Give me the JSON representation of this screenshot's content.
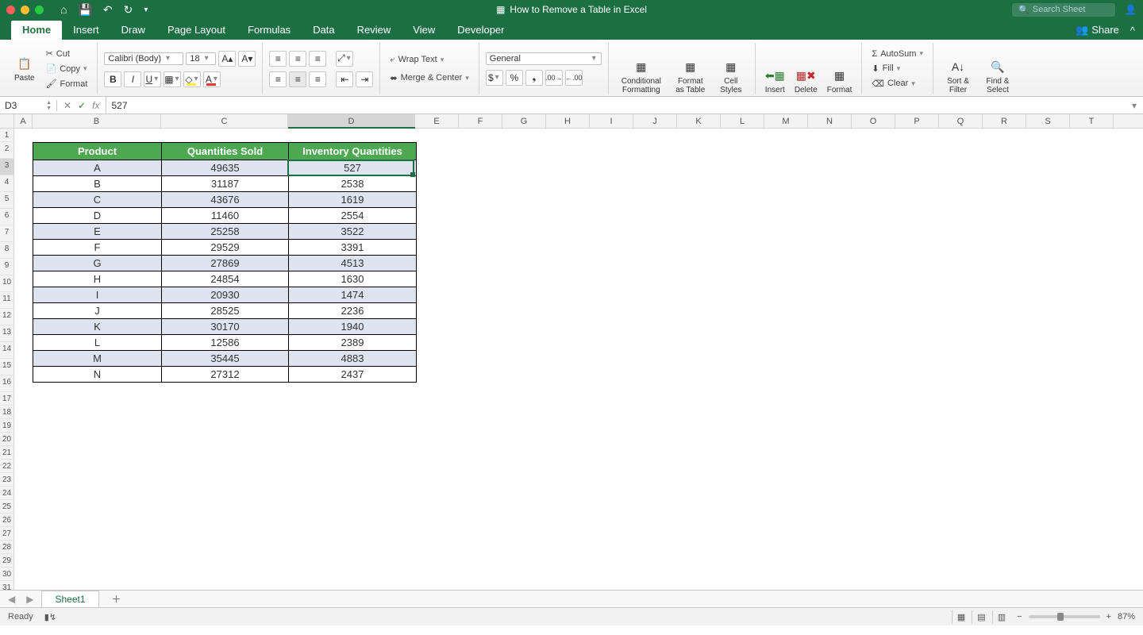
{
  "titlebar": {
    "title": "How to Remove a Table in Excel",
    "search_placeholder": "Search Sheet"
  },
  "tabs": {
    "items": [
      "Home",
      "Insert",
      "Draw",
      "Page Layout",
      "Formulas",
      "Data",
      "Review",
      "View",
      "Developer"
    ],
    "active": "Home",
    "share": "Share"
  },
  "ribbon": {
    "paste": "Paste",
    "cut": "Cut",
    "copy": "Copy",
    "format_painter": "Format",
    "font_name": "Calibri (Body)",
    "font_size": "18",
    "wrap": "Wrap Text",
    "merge": "Merge & Center",
    "number_format": "General",
    "cond_fmt": "Conditional Formatting",
    "as_table": "Format as Table",
    "cell_styles": "Cell Styles",
    "insert": "Insert",
    "delete": "Delete",
    "format": "Format",
    "autosum": "AutoSum",
    "fill": "Fill",
    "clear": "Clear",
    "sort": "Sort & Filter",
    "find": "Find & Select"
  },
  "formula_bar": {
    "cell_ref": "D3",
    "fx": "fx",
    "value": "527"
  },
  "columns": [
    "A",
    "B",
    "C",
    "D",
    "E",
    "F",
    "G",
    "H",
    "I",
    "J",
    "K",
    "L",
    "M",
    "N",
    "O",
    "P",
    "Q",
    "R",
    "S",
    "T"
  ],
  "selected_col": "D",
  "selected_row": 3,
  "table": {
    "headers": [
      "Product",
      "Quantities Sold",
      "Inventory Quantities"
    ],
    "rows": [
      [
        "A",
        "49635",
        "527"
      ],
      [
        "B",
        "31187",
        "2538"
      ],
      [
        "C",
        "43676",
        "1619"
      ],
      [
        "D",
        "11460",
        "2554"
      ],
      [
        "E",
        "25258",
        "3522"
      ],
      [
        "F",
        "29529",
        "3391"
      ],
      [
        "G",
        "27869",
        "4513"
      ],
      [
        "H",
        "24854",
        "1630"
      ],
      [
        "I",
        "20930",
        "1474"
      ],
      [
        "J",
        "28525",
        "2236"
      ],
      [
        "K",
        "30170",
        "1940"
      ],
      [
        "L",
        "12586",
        "2389"
      ],
      [
        "M",
        "35445",
        "4883"
      ],
      [
        "N",
        "27312",
        "2437"
      ]
    ]
  },
  "sheet_tabs": {
    "active": "Sheet1"
  },
  "status": {
    "ready": "Ready",
    "zoom": "87%"
  },
  "colors": {
    "brand": "#1b6f43",
    "table_header": "#4ea852",
    "band": "#dde4f0"
  }
}
